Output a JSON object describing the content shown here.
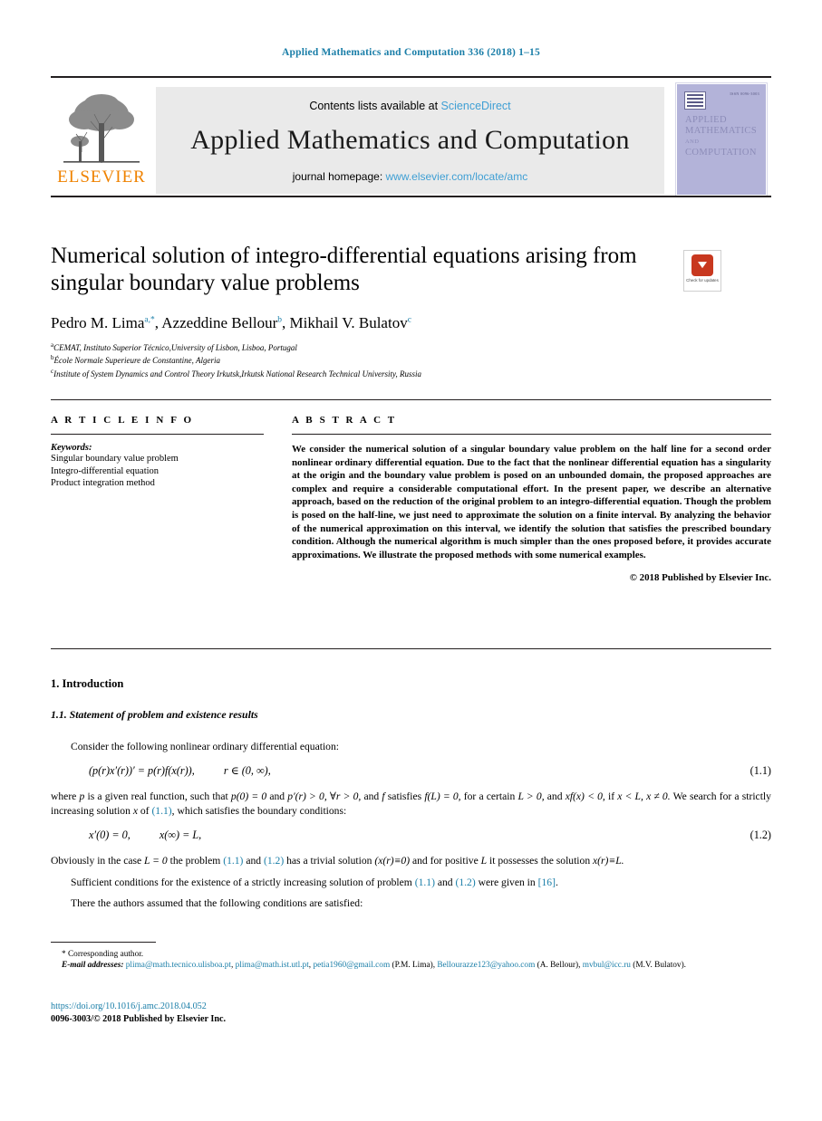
{
  "running_head": "Applied Mathematics and Computation 336 (2018) 1–15",
  "banner": {
    "contents_prefix": "Contents lists available at",
    "contents_link": "ScienceDirect",
    "journal_title": "Applied Mathematics and Computation",
    "homepage_prefix": "journal homepage:",
    "homepage_link": "www.elsevier.com/locate/amc",
    "publisher_logo_text": "ELSEVIER",
    "cover": {
      "issn": "ISSN 0096-3003",
      "line1": "APPLIED",
      "line2": "MATHEMATICS",
      "line3": "AND",
      "line4": "COMPUTATION"
    }
  },
  "article": {
    "title": "Numerical solution of integro-differential equations arising from singular boundary value problems",
    "check_for_updates": "Check for updates",
    "authors_html": "Pedro M. Lima<sup>a,*</sup>, Azzeddine Bellour<sup>b</sup>, Mikhail V. Bulatov<sup>c</sup>",
    "affiliations": [
      {
        "mark": "a",
        "text": "CEMAT, Instituto Superior Técnico,University of Lisbon, Lisboa, Portugal"
      },
      {
        "mark": "b",
        "text": "École Normale Superieure de Constantine, Algeria"
      },
      {
        "mark": "c",
        "text": "Institute of System Dynamics and Control Theory Irkutsk,Irkutsk National Research Technical University, Russia"
      }
    ]
  },
  "article_info": {
    "heading": "A R T I C L E   I N F O",
    "keywords_label": "Keywords:",
    "keywords": [
      "Singular boundary value problem",
      "Integro-differential equation",
      "Product integration method"
    ]
  },
  "abstract": {
    "heading": "A B S T R A C T",
    "text": "We consider the numerical solution of a singular boundary value problem on the half line for a second order nonlinear ordinary differential equation. Due to the fact that the nonlinear differential equation has a singularity at the origin and the boundary value problem is posed on an unbounded domain, the proposed approaches are complex and require a considerable computational effort. In the present paper, we describe an alternative approach, based on the reduction of the original problem to an integro-differential equation. Though the problem is posed on the half-line, we just need to approximate the solution on a finite interval. By analyzing the behavior of the numerical approximation on this interval, we identify the solution that satisfies the prescribed boundary condition. Although the numerical algorithm is much simpler than the ones proposed before, it provides accurate approximations. We illustrate the proposed methods with some numerical examples.",
    "copyright": "© 2018 Published by Elsevier Inc."
  },
  "body": {
    "section_number_title": "1. Introduction",
    "subsection_number_title": "1.1. Statement of problem and existence results",
    "p_consider": "Consider the following nonlinear ordinary differential equation:",
    "eq1": {
      "lhs": "(p(r)x′(r))′ = p(r)f(x(r)),",
      "domain": "r ∈ (0, ∞),",
      "number": "(1.1)"
    },
    "p_where_a": "where ",
    "p_where_b": "p",
    "p_where_c": " is a given real function, such that ",
    "p_where_d": "p(0) = 0",
    "p_where_e": " and ",
    "p_where_f": "p′(r) > 0, ∀r > 0,",
    "p_where_g": " and ",
    "p_where_h": "f",
    "p_where_i": " satisfies ",
    "p_where_j": "f(L) = 0,",
    "p_where_k": " for a certain ",
    "p_where_l": "L > 0,",
    "p_where_m": " and ",
    "p_where_n": "xf(x) < 0,",
    "p_where_o": " if ",
    "p_where_p": "x < L, x ≠ 0.",
    "p_where_q": " We search for a strictly increasing solution ",
    "p_where_r": "x",
    "p_where_s": " of ",
    "p_where_ref": "(1.1)",
    "p_where_t": ", which satisfies the boundary conditions:",
    "eq2": {
      "lhs": "x′(0) = 0,",
      "rhs": "x(∞) = L,",
      "number": "(1.2)"
    },
    "p_obviously_1": "Obviously in the case ",
    "p_obviously_2": "L = 0",
    "p_obviously_3": " the problem ",
    "p_obviously_ref1": "(1.1)",
    "p_obviously_4": " and ",
    "p_obviously_ref2": "(1.2)",
    "p_obviously_5": " has a trivial solution ",
    "p_obviously_6": "(x(r)≡0)",
    "p_obviously_7": " and for positive ",
    "p_obviously_8": "L",
    "p_obviously_9": " it possesses the solution ",
    "p_obviously_10": "x(r)≡L.",
    "p_sufficient_1": "Sufficient conditions for the existence of a strictly increasing solution of problem ",
    "p_sufficient_ref1": "(1.1)",
    "p_sufficient_2": " and ",
    "p_sufficient_ref2": "(1.2)",
    "p_sufficient_3": " were given in ",
    "p_sufficient_ref3": "[16]",
    "p_sufficient_4": ".",
    "p_there": "There the authors assumed that the following conditions are satisfied:"
  },
  "footnote": {
    "corresponding": "Corresponding author.",
    "email_label": "E-mail addresses:",
    "emails": [
      {
        "address": "plima@math.tecnico.ulisboa.pt",
        "sep": ", "
      },
      {
        "address": "plima@math.ist.utl.pt",
        "sep": ", "
      },
      {
        "address": "petia1960@gmail.com",
        "sep": " "
      }
    ],
    "owner1": "(P.M. Lima),",
    "email4": "Bellourazze123@yahoo.com",
    "owner2": "(A. Bellour),",
    "email5": "mvbul@icc.ru",
    "owner3": "(M.V. Bulatov).",
    "doi": "https://doi.org/10.1016/j.amc.2018.04.052",
    "issn_copyright": "0096-3003/© 2018 Published by Elsevier Inc."
  },
  "colors": {
    "link": "#1a7ea8",
    "science_direct": "#3f9fd4",
    "elsevier_orange": "#ef8200",
    "cover_bg": "#b3b3d9"
  }
}
